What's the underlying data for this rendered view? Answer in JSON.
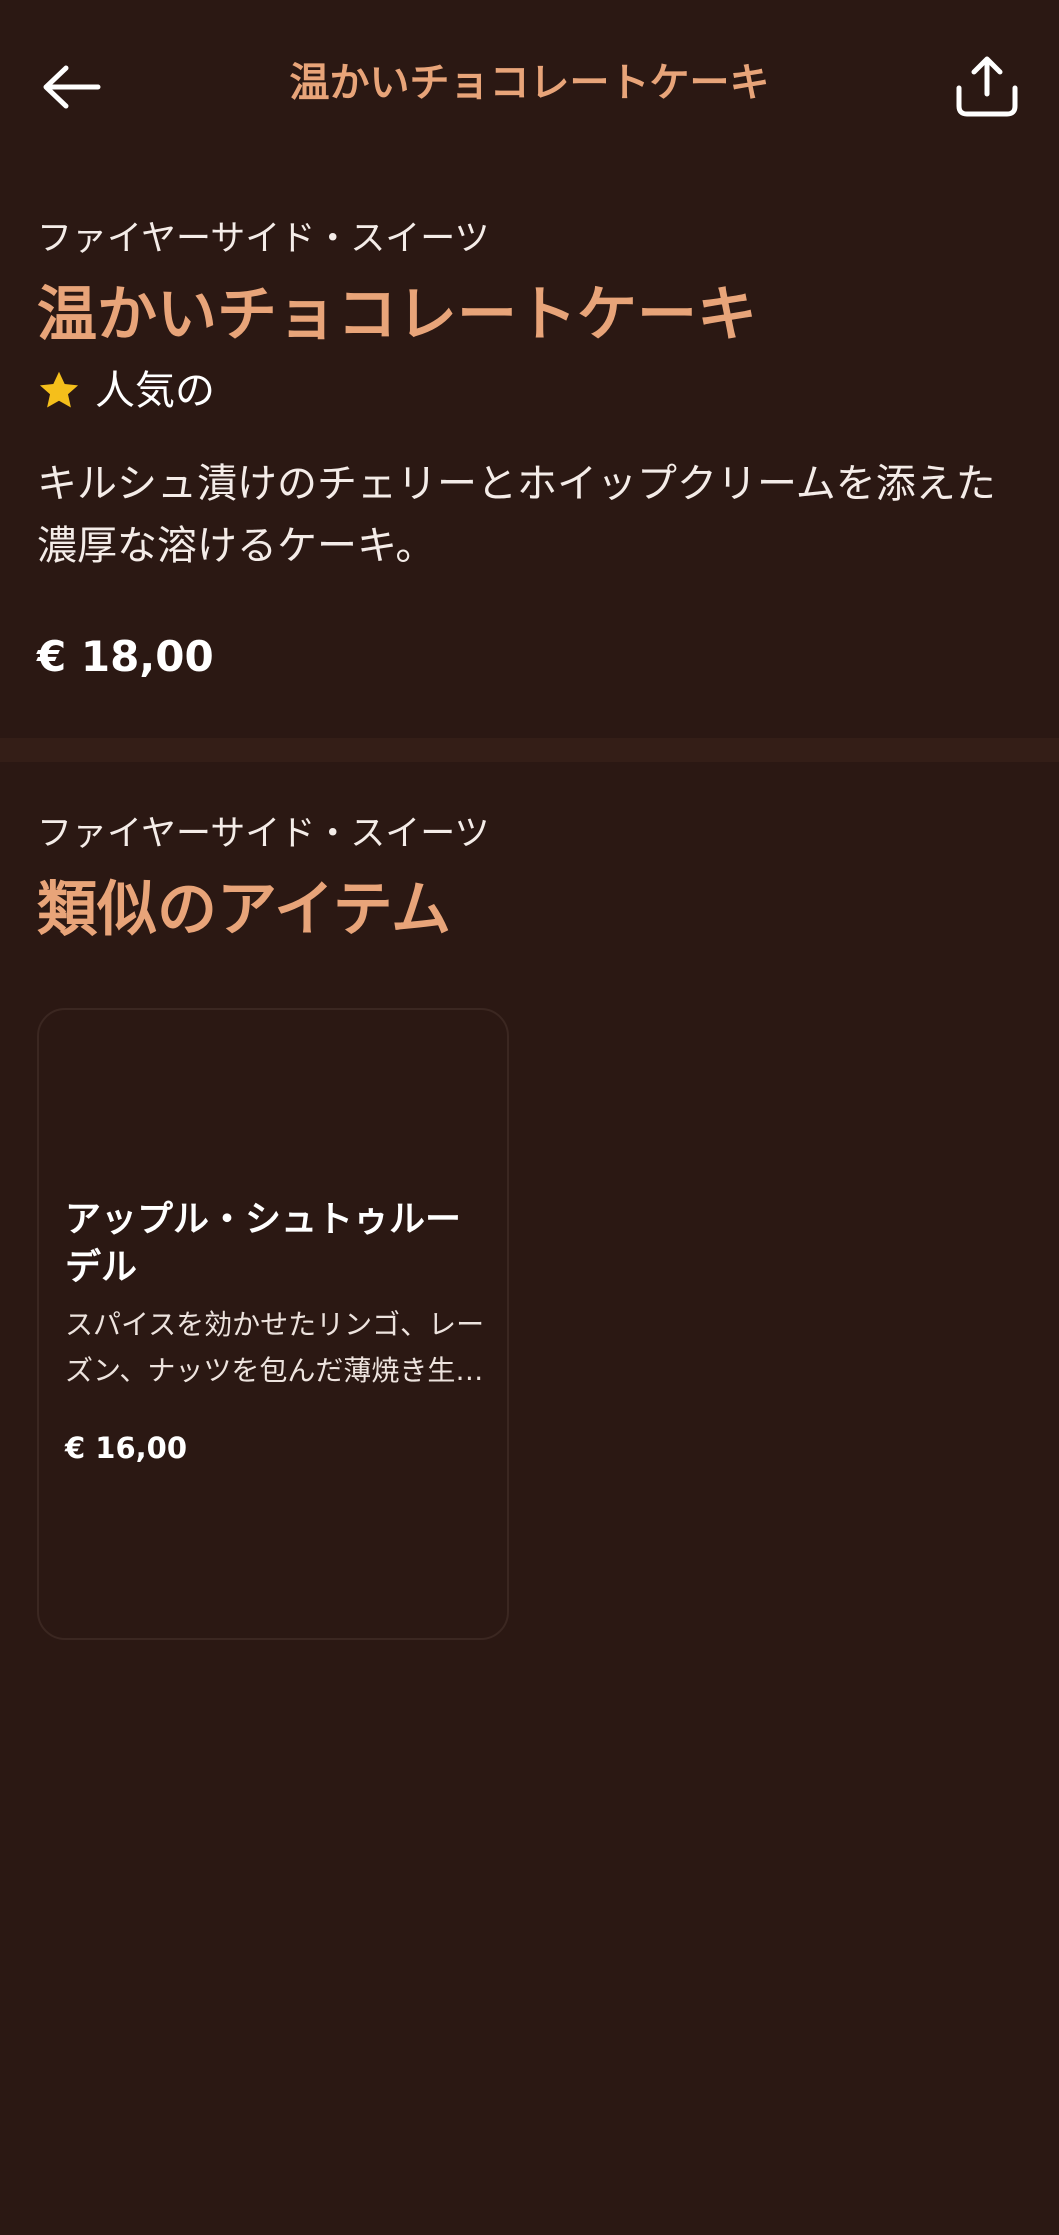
{
  "header": {
    "title": "温かいチョコレートケーキ",
    "back_icon": "arrow-left-icon",
    "share_icon": "share-icon"
  },
  "product": {
    "category": "ファイヤーサイド・スイーツ",
    "title": "温かいチョコレートケーキ",
    "badge": "人気の",
    "badge_icon": "star-icon",
    "description": "キルシュ漬けのチェリーとホイップクリームを添えた濃厚な溶けるケーキ。",
    "price": "€ 18,00"
  },
  "similar": {
    "category": "ファイヤーサイド・スイーツ",
    "title": "類似のアイテム",
    "items": [
      {
        "name": "アップル・シュトゥルーデル",
        "description": "スパイスを効かせたリンゴ、レーズン、ナッツを包んだ薄焼き生地のペストリー。",
        "price": "€ 16,00"
      }
    ]
  },
  "colors": {
    "background": "#2b1813",
    "accent": "#e8a479",
    "star": "#f5bf1b",
    "divider": "#341e17"
  }
}
